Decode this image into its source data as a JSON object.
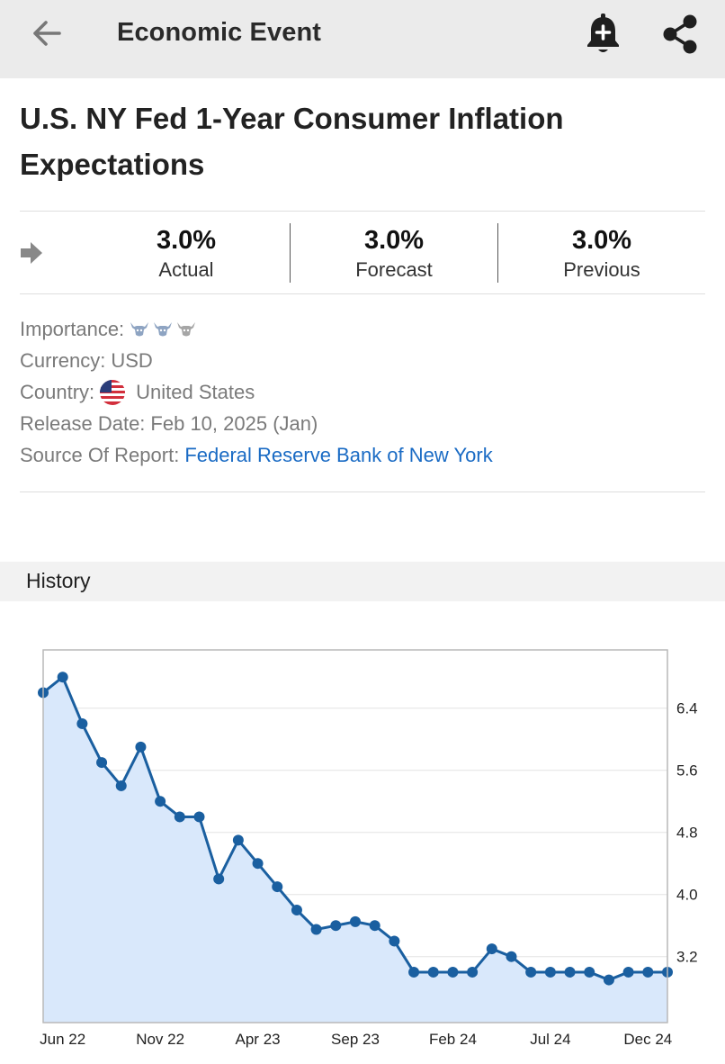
{
  "topbar": {
    "title": "Economic Event",
    "back_icon": "arrow-left-icon",
    "bell_icon": "bell-add-icon",
    "share_icon": "share-icon"
  },
  "event": {
    "title": "U.S. NY Fed 1-Year Consumer Inflation Expectations"
  },
  "stats": {
    "actual": {
      "value": "3.0%",
      "label": "Actual"
    },
    "forecast": {
      "value": "3.0%",
      "label": "Forecast"
    },
    "previous": {
      "value": "3.0%",
      "label": "Previous"
    },
    "status_icon": "arrow-right-icon"
  },
  "details": {
    "importance_label": "Importance:",
    "importance_level": 1,
    "importance_max": 3,
    "currency_label": "Currency:",
    "currency_value": "USD",
    "country_label": "Country:",
    "country_value": "United States",
    "release_label": "Release Date:",
    "release_value": "Feb 10, 2025 (Jan)",
    "source_label": "Source Of Report:",
    "source_value": "Federal Reserve Bank of New York"
  },
  "colors": {
    "accent_link": "#1a6bc4",
    "line": "#1a5fa0",
    "area": "#d9e8fb",
    "bull_active": "#8ea4c2",
    "bull_inactive": "#a6a6a6"
  },
  "history": {
    "label": "History"
  },
  "chart_data": {
    "type": "area",
    "title": "",
    "xlabel": "",
    "ylabel": "",
    "ylim": [
      2.35,
      7.15
    ],
    "yticks": [
      "6.4",
      "5.6",
      "4.8",
      "4.0",
      "3.2"
    ],
    "ytick_values": [
      6.4,
      5.6,
      4.8,
      4.0,
      3.2
    ],
    "xtick_labels": [
      "Jun 22",
      "Nov 22",
      "Apr 23",
      "Sep 23",
      "Feb 24",
      "Jul 24",
      "Dec 24"
    ],
    "xtick_index": [
      1,
      6,
      11,
      16,
      21,
      26,
      31
    ],
    "axis_position": "right",
    "grid": true,
    "series": [
      {
        "values": [
          6.6,
          6.8,
          6.2,
          5.7,
          5.4,
          5.9,
          5.2,
          5.0,
          5.0,
          4.2,
          4.7,
          4.4,
          4.1,
          3.8,
          3.55,
          3.6,
          3.65,
          3.6,
          3.4,
          3.0,
          3.0,
          3.0,
          3.0,
          3.3,
          3.2,
          3.0,
          3.0,
          3.0,
          3.0,
          2.9,
          3.0,
          3.0,
          3.0
        ]
      }
    ]
  }
}
